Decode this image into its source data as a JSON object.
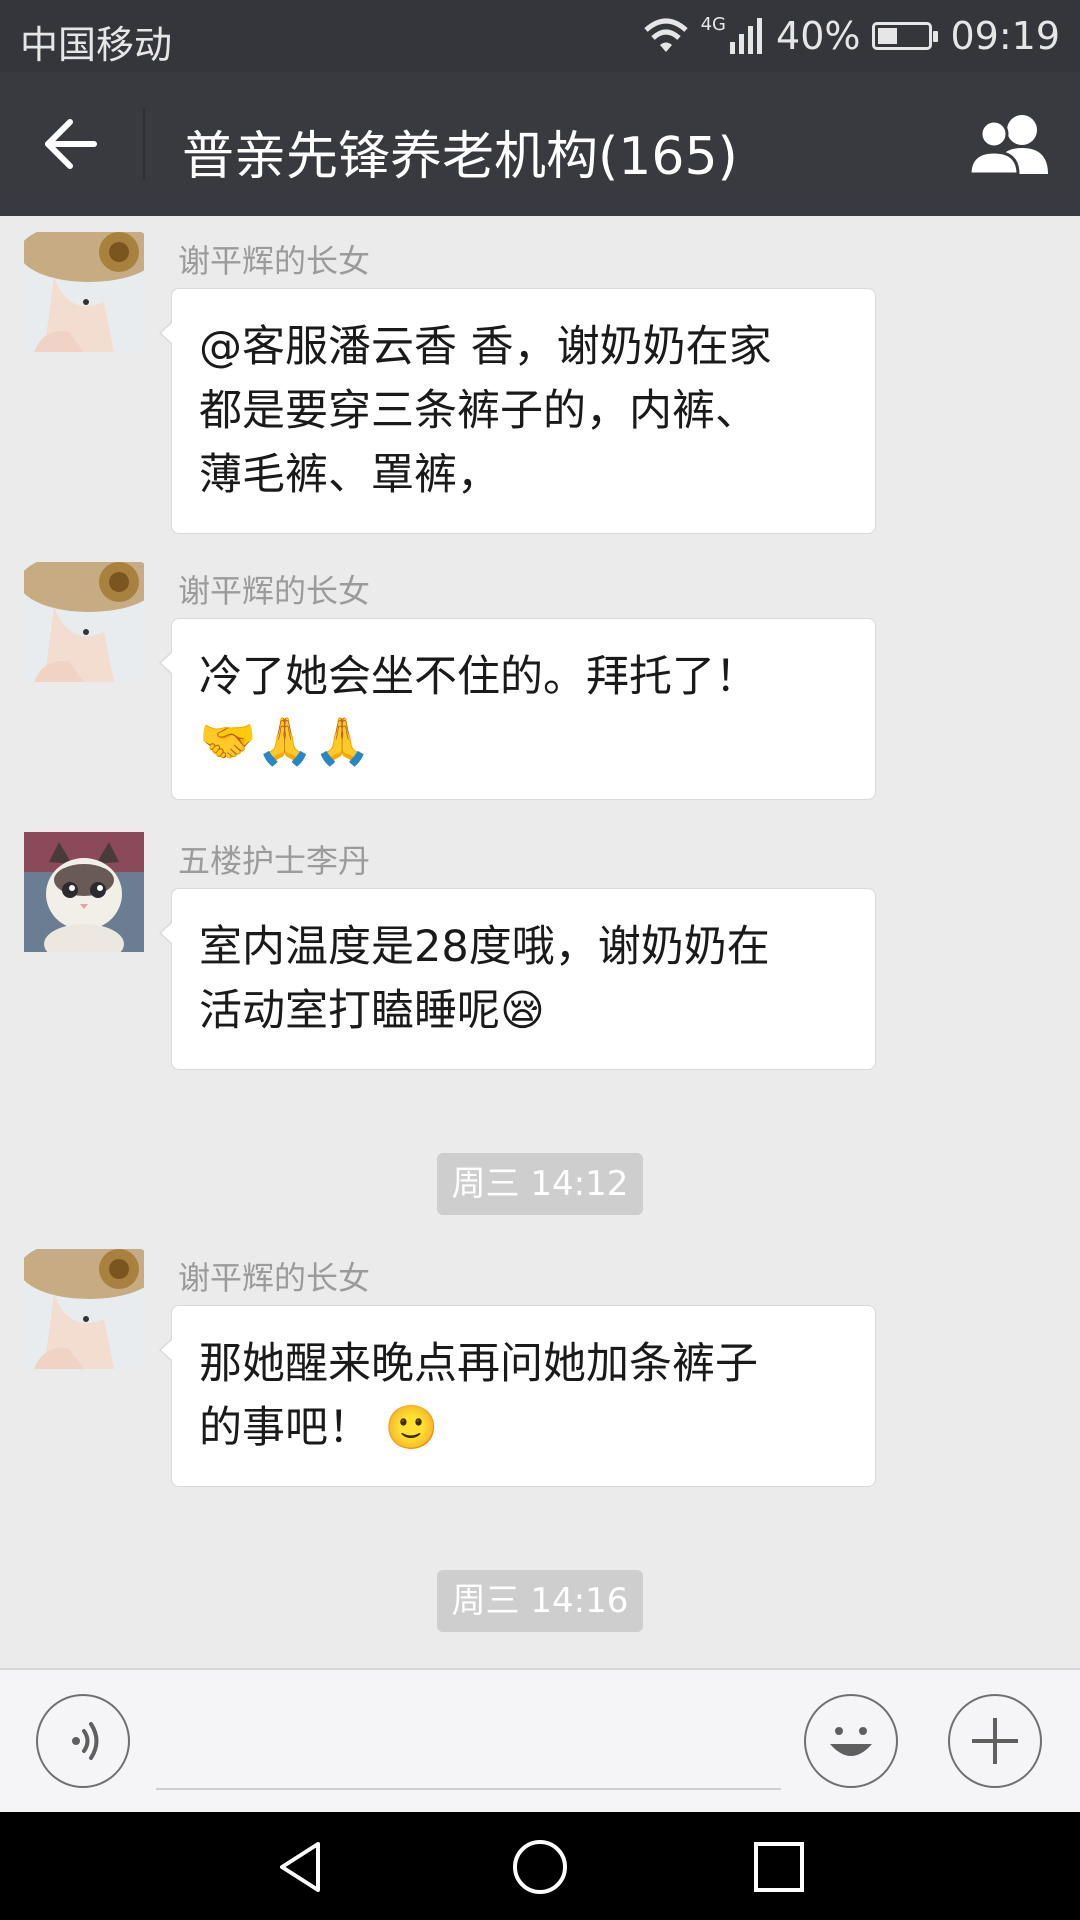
{
  "status_bar": {
    "carrier": "中国移动",
    "network": "4G",
    "battery_percent": "40%",
    "battery_level": 0.4,
    "time": "09:19"
  },
  "header": {
    "title": "普亲先锋养老机构(165)",
    "back_icon": "back-arrow-icon",
    "members_icon": "group-members-icon"
  },
  "messages": [
    {
      "sender": "谢平辉的长女",
      "avatar": "woman-hat-avatar",
      "text_lines": [
        "@客服潘云香 香，谢奶奶在家",
        "都是要穿三条裤子的，内裤、",
        "薄毛裤、罩裤，"
      ]
    },
    {
      "sender": "谢平辉的长女",
      "avatar": "woman-hat-avatar",
      "text_lines": [
        "冷了她会坐不住的。拜托了！"
      ],
      "emoji_line": "🤝🙏🙏"
    },
    {
      "sender": "五楼护士李丹",
      "avatar": "cat-avatar",
      "text_lines": [
        "室内温度是28度哦，谢奶奶在",
        "活动室打瞌睡呢😪"
      ]
    },
    {
      "sender": "谢平辉的长女",
      "avatar": "woman-hat-avatar",
      "text_lines": [
        "那她醒来晚点再问她加条裤子",
        "的事吧！ 🙂"
      ]
    }
  ],
  "timestamps": [
    "周三 14:12",
    "周三 14:16"
  ],
  "input_bar": {
    "voice_icon": "voice-input-icon",
    "emoji_icon": "emoji-icon",
    "plus_icon": "plus-icon",
    "text_value": ""
  },
  "nav_bar": {
    "back": "nav-back-icon",
    "home": "nav-home-icon",
    "recents": "nav-recents-icon"
  },
  "colors": {
    "header_bg": "#393a3f",
    "status_bg": "#35363b",
    "chat_bg": "#ebebeb",
    "bubble_bg": "#ffffff",
    "timestamp_bg": "#cecece"
  }
}
